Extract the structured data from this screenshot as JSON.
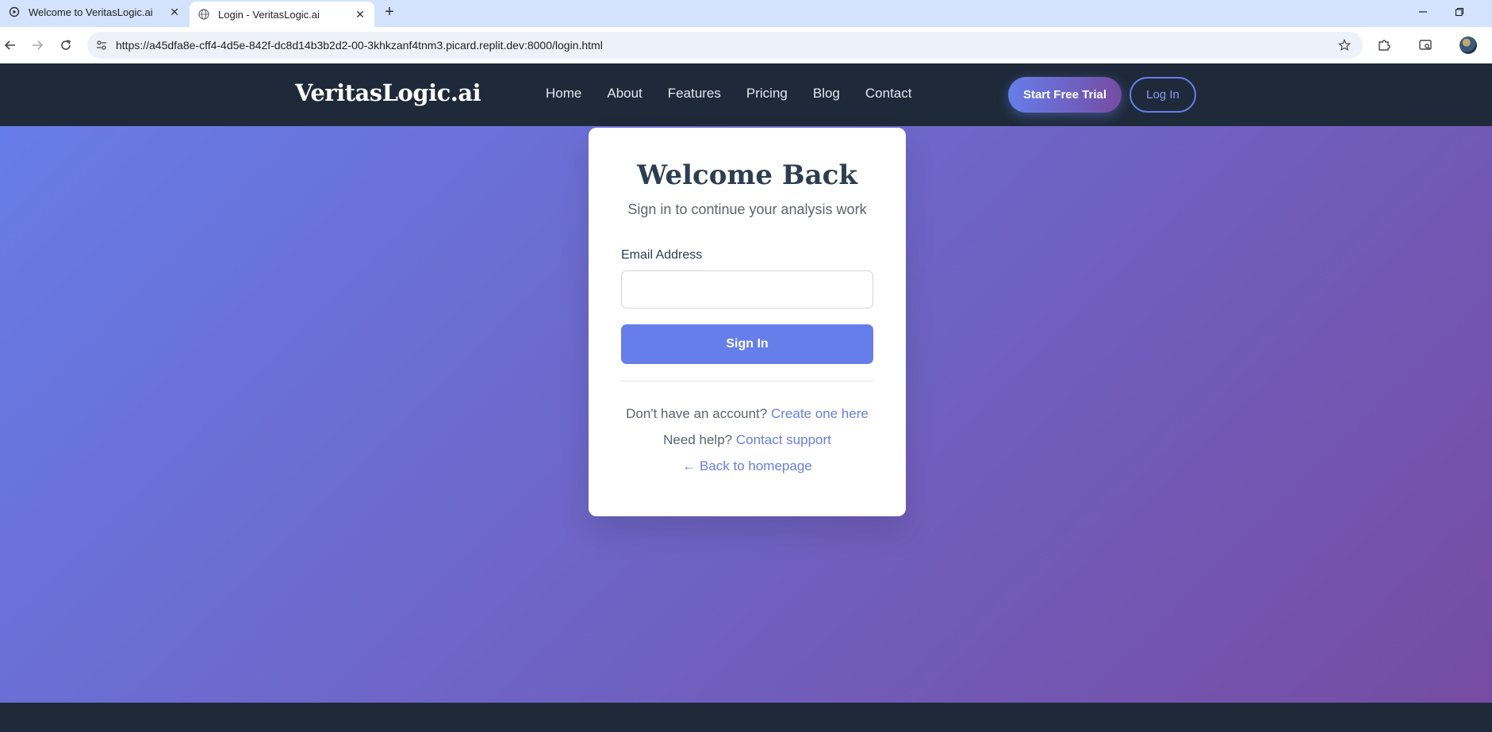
{
  "browser": {
    "tabs": [
      {
        "title": "Welcome to VeritasLogic.ai",
        "active": false
      },
      {
        "title": "Login - VeritasLogic.ai",
        "active": true
      }
    ],
    "url": "https://a45dfa8e-cff4-4d5e-842f-dc8d14b3b2d2-00-3khkzanf4tnm3.picard.replit.dev:8000/login.html"
  },
  "site": {
    "brand": "VeritasLogic.ai",
    "nav": [
      "Home",
      "About",
      "Features",
      "Pricing",
      "Blog",
      "Contact"
    ],
    "cta_trial": "Start Free Trial",
    "cta_login": "Log In"
  },
  "login": {
    "title": "Welcome Back",
    "subtitle": "Sign in to continue your analysis work",
    "email_label": "Email Address",
    "email_value": "",
    "submit": "Sign In",
    "no_account_text": "Don't have an account?",
    "create_link": "Create one here",
    "help_text": "Need help?",
    "support_link": "Contact support",
    "back_link": "← Back to homepage"
  },
  "colors": {
    "accent": "#667eea",
    "gradient_end": "#764ba2",
    "nav_bg": "#1e2a3a",
    "heading": "#2c3e50"
  }
}
